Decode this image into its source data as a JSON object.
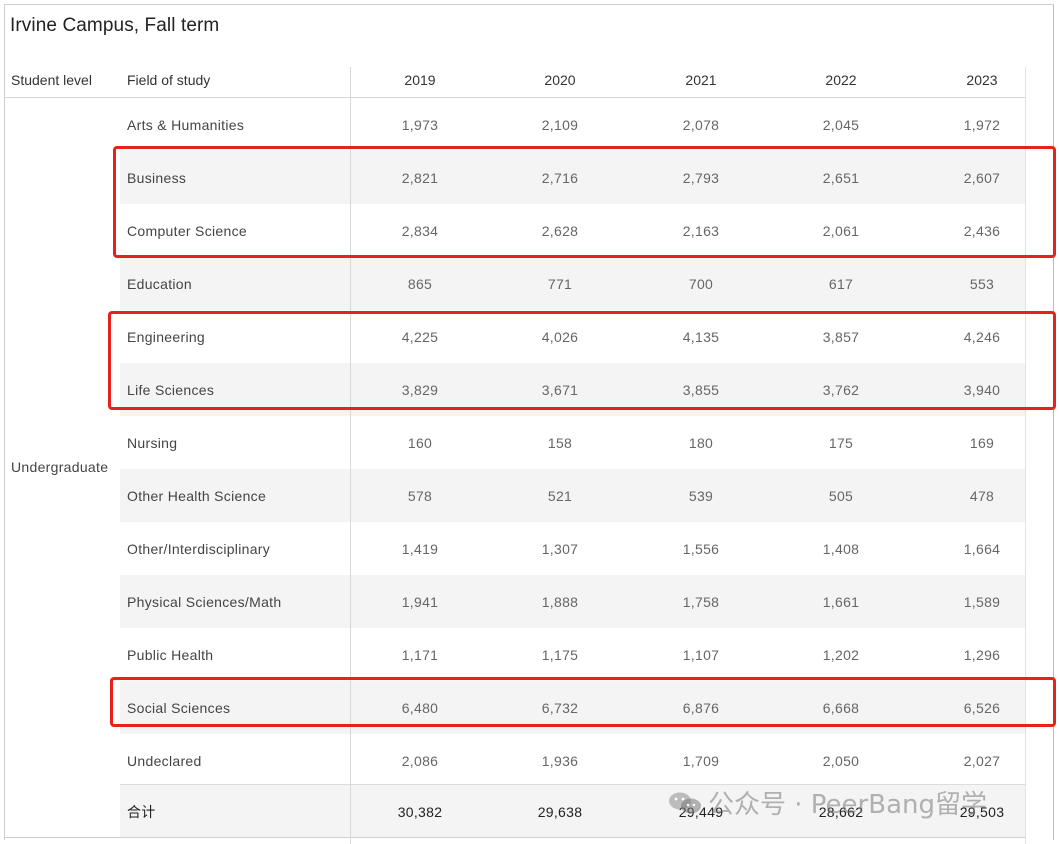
{
  "title": "Irvine Campus, Fall term",
  "headers": {
    "student_level": "Student level",
    "field": "Field of study",
    "years": [
      "2019",
      "2020",
      "2021",
      "2022",
      "2023"
    ]
  },
  "student_level_label": "Undergraduate",
  "rows": [
    {
      "field": "Arts & Humanities",
      "values": [
        "1,973",
        "2,109",
        "2,078",
        "2,045",
        "1,972"
      ]
    },
    {
      "field": "Business",
      "values": [
        "2,821",
        "2,716",
        "2,793",
        "2,651",
        "2,607"
      ]
    },
    {
      "field": "Computer Science",
      "values": [
        "2,834",
        "2,628",
        "2,163",
        "2,061",
        "2,436"
      ]
    },
    {
      "field": "Education",
      "values": [
        "865",
        "771",
        "700",
        "617",
        "553"
      ]
    },
    {
      "field": "Engineering",
      "values": [
        "4,225",
        "4,026",
        "4,135",
        "3,857",
        "4,246"
      ]
    },
    {
      "field": "Life Sciences",
      "values": [
        "3,829",
        "3,671",
        "3,855",
        "3,762",
        "3,940"
      ]
    },
    {
      "field": "Nursing",
      "values": [
        "160",
        "158",
        "180",
        "175",
        "169"
      ]
    },
    {
      "field": "Other Health Science",
      "values": [
        "578",
        "521",
        "539",
        "505",
        "478"
      ]
    },
    {
      "field": "Other/Interdisciplinary",
      "values": [
        "1,419",
        "1,307",
        "1,556",
        "1,408",
        "1,664"
      ]
    },
    {
      "field": "Physical Sciences/Math",
      "values": [
        "1,941",
        "1,888",
        "1,758",
        "1,661",
        "1,589"
      ]
    },
    {
      "field": "Public Health",
      "values": [
        "1,171",
        "1,175",
        "1,107",
        "1,202",
        "1,296"
      ]
    },
    {
      "field": "Social Sciences",
      "values": [
        "6,480",
        "6,732",
        "6,876",
        "6,668",
        "6,526"
      ]
    },
    {
      "field": "Undeclared",
      "values": [
        "2,086",
        "1,936",
        "1,709",
        "2,050",
        "2,027"
      ]
    }
  ],
  "total": {
    "field": "合计",
    "values": [
      "30,382",
      "29,638",
      "29,449",
      "28,662",
      "29,503"
    ]
  },
  "highlight_color": "#e8211e",
  "watermark": "公众号 · PeerBang留学"
}
